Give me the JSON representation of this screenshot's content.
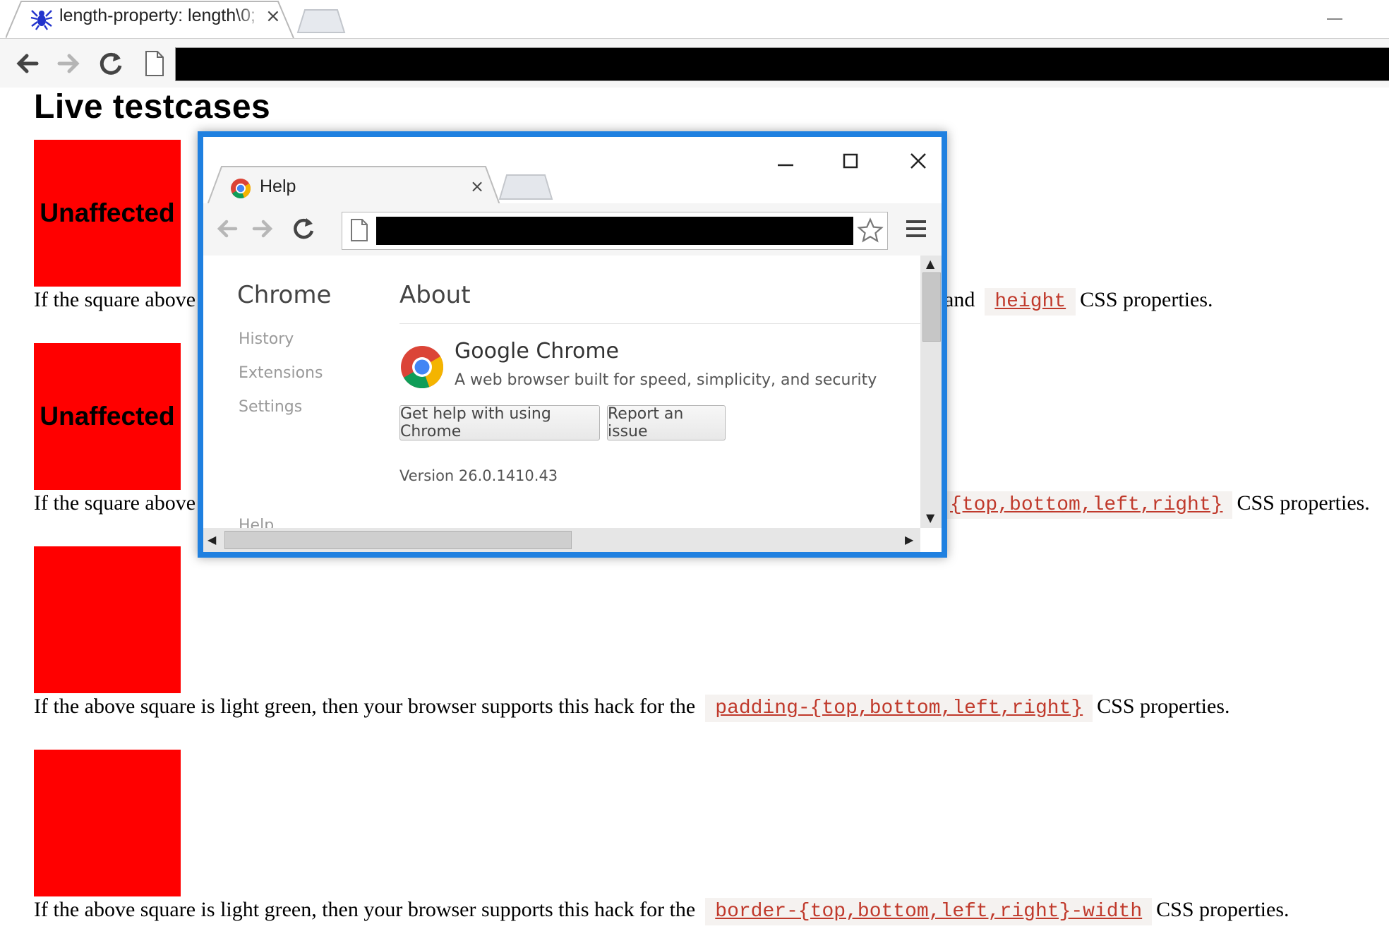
{
  "browser": {
    "tab_title": "length-property: length\\0;",
    "tab_close": "×",
    "icons": {
      "favicon": "spider-icon",
      "back": "back-arrow-icon",
      "forward": "forward-arrow-icon",
      "reload": "reload-icon",
      "page": "page-icon"
    }
  },
  "page": {
    "title": "Live testcases",
    "square_color": "#ff0000",
    "sections": [
      {
        "square_label": "Unaffected",
        "text_before": "If the square above",
        "text_after_fragment": "and",
        "code": "height",
        "text_after": "CSS properties."
      },
      {
        "square_label": "Unaffected",
        "text_before": "If the square above",
        "code": "{top,bottom,left,right}",
        "text_after": "CSS properties."
      },
      {
        "square_label": "",
        "text_before": "If the above square is light green, then your browser supports this hack for the",
        "code": "padding-{top,bottom,left,right}",
        "text_after": "CSS properties."
      },
      {
        "square_label": "",
        "text_before": "If the above square is light green, then your browser supports this hack for the",
        "code": "border-{top,bottom,left,right}-width",
        "text_after": "CSS properties."
      }
    ]
  },
  "popup": {
    "accent_color": "#1f80e0",
    "tab_title": "Help",
    "tab_close": "×",
    "sidebar": {
      "title": "Chrome",
      "items": [
        "History",
        "Extensions",
        "Settings",
        "Help"
      ]
    },
    "main": {
      "title": "About",
      "product_name": "Google Chrome",
      "tagline": "A web browser built for speed, simplicity, and security",
      "buttons": {
        "help": "Get help with using Chrome",
        "report": "Report an issue"
      },
      "version": "Version 26.0.1410.43"
    },
    "icons": {
      "minimize": "minimize-icon",
      "maximize": "maximize-icon",
      "close": "close-icon",
      "star": "star-icon",
      "menu": "menu-icon"
    }
  }
}
